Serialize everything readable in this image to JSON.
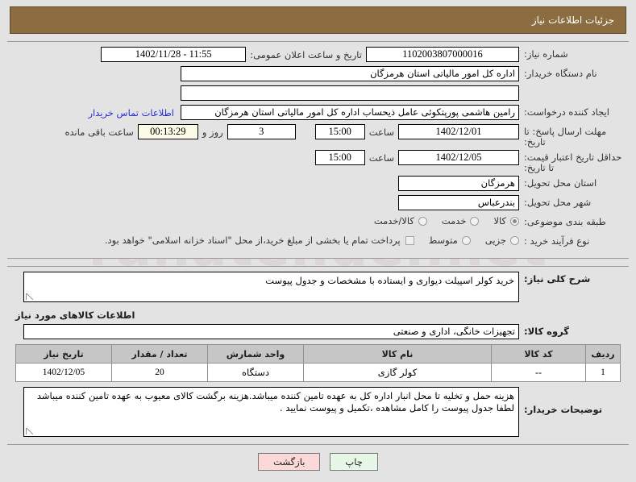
{
  "header": {
    "title": "جزئیات اطلاعات نیاز"
  },
  "info_panel": {
    "rows": {
      "need_number_label": "شماره نیاز:",
      "need_number_value": "1102003807000016",
      "announce_datetime_label": "تاریخ و ساعت اعلان عمومی:",
      "announce_datetime_value": "11:55 - 1402/11/28",
      "buyer_org_label": "نام دستگاه خریدار:",
      "buyer_org_value": "اداره کل امور مالیاتی استان هرمزگان",
      "blank_value": "",
      "creator_label": "ایجاد کننده درخواست:",
      "creator_value": "رامین هاشمی پورپتکوئی عامل ذیحساب اداره کل امور مالیاتی استان هرمزگان",
      "contact_link": "اطلاعات تماس خریدار",
      "deadline_label": "مهلت ارسال پاسخ: تا تاریخ:",
      "deadline_date": "1402/12/01",
      "hour_label": "ساعت",
      "deadline_time": "15:00",
      "days_value": "3",
      "days_and_label": "روز و",
      "countdown_value": "00:13:29",
      "countdown_label": "ساعت باقی مانده",
      "price_validity_label": "حداقل تاریخ اعتبار قیمت: تا تاریخ:",
      "price_validity_date": "1402/12/05",
      "price_validity_time": "15:00",
      "province_label": "استان محل تحویل:",
      "province_value": "هرمزگان",
      "city_label": "شهر محل تحویل:",
      "city_value": "بندرعباس",
      "category_label": "طبقه بندی موضوعی:",
      "process_type_label": "نوع فرآیند خرید :"
    },
    "category_options": [
      {
        "label": "کالا",
        "selected": true
      },
      {
        "label": "خدمت",
        "selected": false
      },
      {
        "label": "کالا/خدمت",
        "selected": false
      }
    ],
    "process_options": [
      {
        "label": "جزیی",
        "selected": false
      },
      {
        "label": "متوسط",
        "selected": false
      }
    ],
    "treasury_checkbox": {
      "checked": false,
      "text": "پرداخت تمام یا بخشی از مبلغ خرید،از محل \"اسناد خزانه اسلامی\" خواهد بود."
    }
  },
  "need_desc": {
    "label": "شرح کلی نیاز:",
    "value": "خرید کولر اسپیلت دیواری و ایستاده با مشخصات و جدول پیوست"
  },
  "goods_section": {
    "title": "اطلاعات کالاهای مورد نیاز",
    "group_label": "گروه کالا:",
    "group_value": "تجهیزات خانگی، اداری و صنعتی",
    "table": {
      "columns": [
        "ردیف",
        "کد کالا",
        "نام کالا",
        "واحد شمارش",
        "تعداد / مقدار",
        "تاریخ نیاز"
      ],
      "rows": [
        {
          "row": "1",
          "code": "--",
          "name": "کولر گازی",
          "unit": "دستگاه",
          "qty": "20",
          "date": "1402/12/05"
        }
      ]
    }
  },
  "buyer_notes": {
    "label": "توضیحات خریدار:",
    "value": "هزینه حمل و تخلیه تا محل انبار اداره کل به عهده تامین کننده میباشد.هزینه برگشت کالای معیوب به عهده تامین کننده میباشد لطفا جدول پیوست را کامل مشاهده ،تکمیل و پیوست نمایید ."
  },
  "footer": {
    "print_label": "چاپ",
    "back_label": "بازگشت"
  },
  "colors": {
    "header_bg": "#8c6d42",
    "page_bg": "#e3e3e3",
    "link": "#2b2bd6",
    "table_header_bg": "#c6c6c6",
    "print_btn_bg": "#e7f7e7",
    "back_btn_bg": "#fbd9d9",
    "countdown_bg": "#fbfbe8"
  },
  "watermark": "rahatender.net"
}
